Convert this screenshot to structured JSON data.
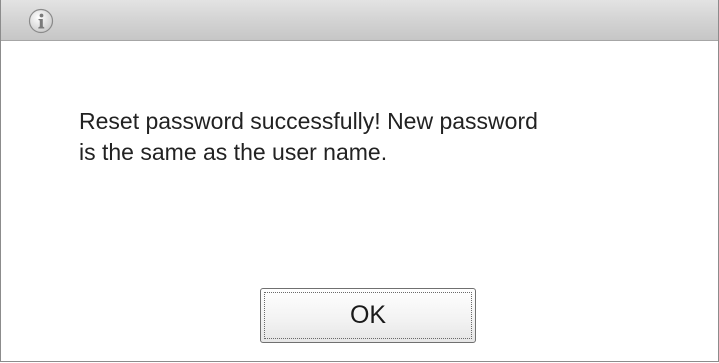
{
  "dialog": {
    "icon": "info-icon",
    "message_line1": "Reset password successfully! New password",
    "message_line2": "is the same as the user name.",
    "ok_label": "OK"
  }
}
